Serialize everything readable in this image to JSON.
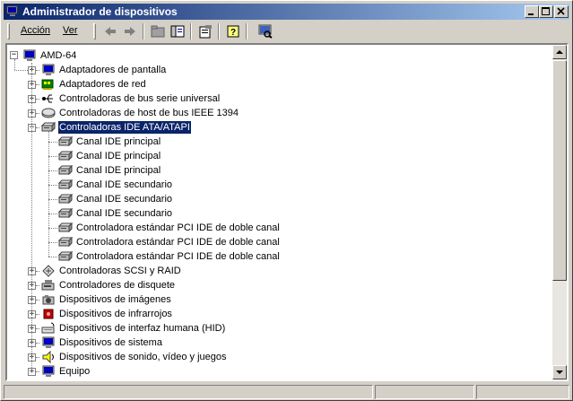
{
  "window": {
    "title": "Administrador de dispositivos"
  },
  "menu": {
    "accion": "Acción",
    "ver": "Ver"
  },
  "toolbar": {
    "icons": [
      "back-icon",
      "forward-icon",
      "folder-view-icon",
      "tree-view-icon",
      "properties-icon",
      "help-icon",
      "scan-hardware-icon"
    ]
  },
  "tree": {
    "root": "AMD-64",
    "categories": [
      "Adaptadores de pantalla",
      "Adaptadores de red",
      "Controladoras de bus serie universal",
      "Controladoras de host de bus IEEE 1394",
      "Controladoras IDE ATA/ATAPI",
      "Controladoras SCSI y RAID",
      "Controladores de disquete",
      "Dispositivos de imágenes",
      "Dispositivos de infrarrojos",
      "Dispositivos de interfaz humana (HID)",
      "Dispositivos de sistema",
      "Dispositivos de sonido, vídeo y juegos",
      "Equipo"
    ],
    "ide_children": [
      "Canal IDE principal",
      "Canal IDE principal",
      "Canal IDE principal",
      "Canal IDE secundario",
      "Canal IDE secundario",
      "Canal IDE secundario",
      "Controladora estándar PCI IDE de doble canal",
      "Controladora estándar PCI IDE de doble canal",
      "Controladora estándar PCI IDE de doble canal"
    ],
    "selected": "Controladoras IDE ATA/ATAPI"
  },
  "colors": {
    "title_start": "#0a246a",
    "title_end": "#a6caf0",
    "selection": "#0a246a",
    "face": "#d4d0c8"
  }
}
